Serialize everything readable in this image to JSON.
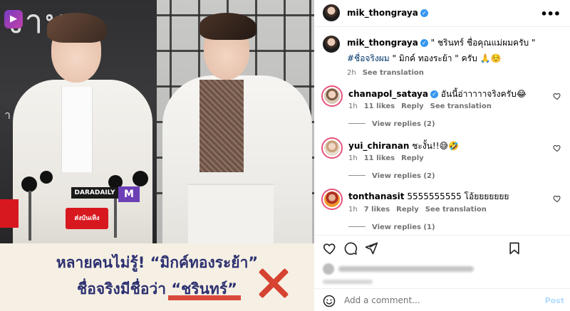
{
  "media": {
    "caption_line1": "หลายคนไม่รู้! “มิกค์ทองระย้า”",
    "caption_line2": "ชื่อจริงมีชื่อว่า “ชรินทร์”",
    "backdrop_text": "งามา",
    "backdrop_text_small": "า",
    "tag_dara": "DARADAILY",
    "tag_m": "M",
    "tag_red": "ส่งบันเทิง"
  },
  "header": {
    "username": "mik_thongraya",
    "verified_mark": "✓",
    "more_icon": "more-horizontal-icon"
  },
  "post": {
    "username": "mik_thongraya",
    "caption_text": " \" ชรินทร์ ชื่อคุณแม่ผมครับ \"",
    "hashtag": "#ชื่อจริงผม",
    "caption_text2": " \" มิกค์ ทองระย้า \" ครับ 🙏☺️",
    "time": "2h",
    "see_translation": "See translation"
  },
  "comments": [
    {
      "username": "chanapol_sataya",
      "verified": true,
      "text": "อันนี้อ่าาาาาจริงครับ😂",
      "time": "1h",
      "likes": "11 likes",
      "reply": "Reply",
      "see_translation": "See translation",
      "view_replies": "View replies (2)"
    },
    {
      "username": "yui_chiranan",
      "verified": false,
      "text": "ชะงั้น!!😅🤣",
      "time": "1h",
      "likes": "11 likes",
      "reply": "Reply",
      "see_translation": "",
      "view_replies": "View replies (2)"
    },
    {
      "username": "tonthanasit",
      "verified": false,
      "text": "5555555555 โอ้ยยยยยยย",
      "time": "1h",
      "likes": "7 likes",
      "reply": "Reply",
      "see_translation": "See translation",
      "view_replies": "View replies (1)"
    }
  ],
  "comment_box": {
    "placeholder": "Add a comment...",
    "post_label": "Post"
  },
  "colors": {
    "verified": "#3897f0",
    "caption_text": "#2c3070",
    "caption_bg": "#f6f0e4",
    "accent_red": "#d64331",
    "post_disabled": "#b3dbff"
  }
}
